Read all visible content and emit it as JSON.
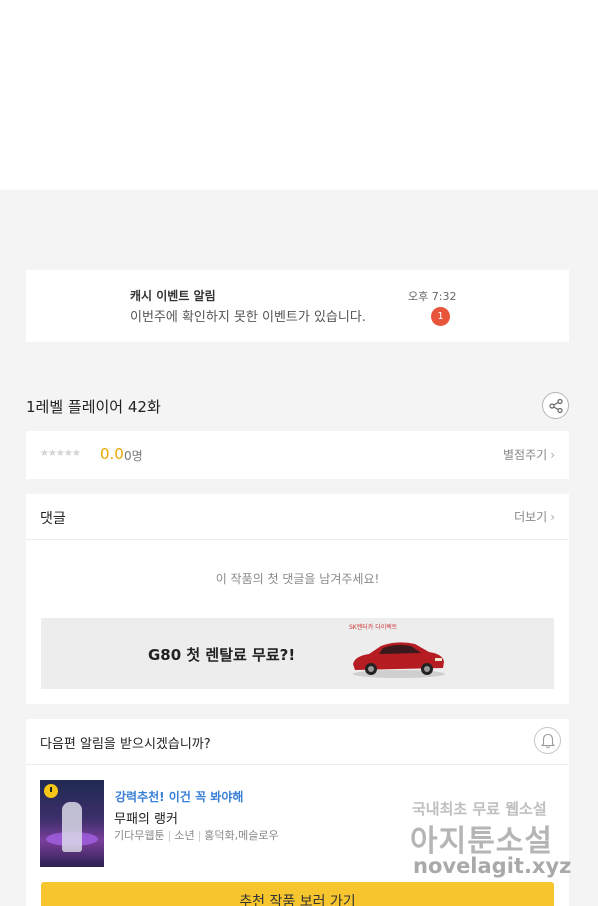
{
  "notification": {
    "title": "캐시 이벤트 알림",
    "message": "이번주에 확인하지 못한 이벤트가 있습니다.",
    "time": "오후 7:32",
    "badge_count": "1"
  },
  "episode": {
    "title": "1레벨 플레이어 42화",
    "share_icon": "share-icon"
  },
  "rating": {
    "stars": "★★★★★",
    "filled_stars": 0,
    "score": "0.0",
    "count": "0명",
    "rate_link": "별점주기"
  },
  "comments": {
    "heading": "댓글",
    "more_link": "더보기",
    "empty_message": "이 작품의 첫 댓글을 남겨주세요!"
  },
  "ad": {
    "text": "G80 첫 렌탈료 무료?!",
    "logo_text": "SK렌터카 다이렉트",
    "car_color": "#b51d22"
  },
  "subscribe": {
    "question": "다음편 알림을 받으시겠습니까?",
    "bell_icon": "bell-icon"
  },
  "recommendation": {
    "tag": "강력추천! 이건 꼭 봐야해",
    "title": "무패의 랭커",
    "platform": "기다무웹툰",
    "genre": "소년",
    "authors": "홍덕화,메슬로우",
    "button": "추천 작품 보러 가기"
  },
  "watermark": {
    "line1": "국내최초 무료 웹소설",
    "line2": "아지툰소설",
    "line3": "novelagit.xyz"
  },
  "colors": {
    "accent_yellow": "#f7c62f",
    "badge_red": "#e9553b",
    "score_orange": "#e8a600",
    "tag_blue": "#3a7fd6"
  }
}
